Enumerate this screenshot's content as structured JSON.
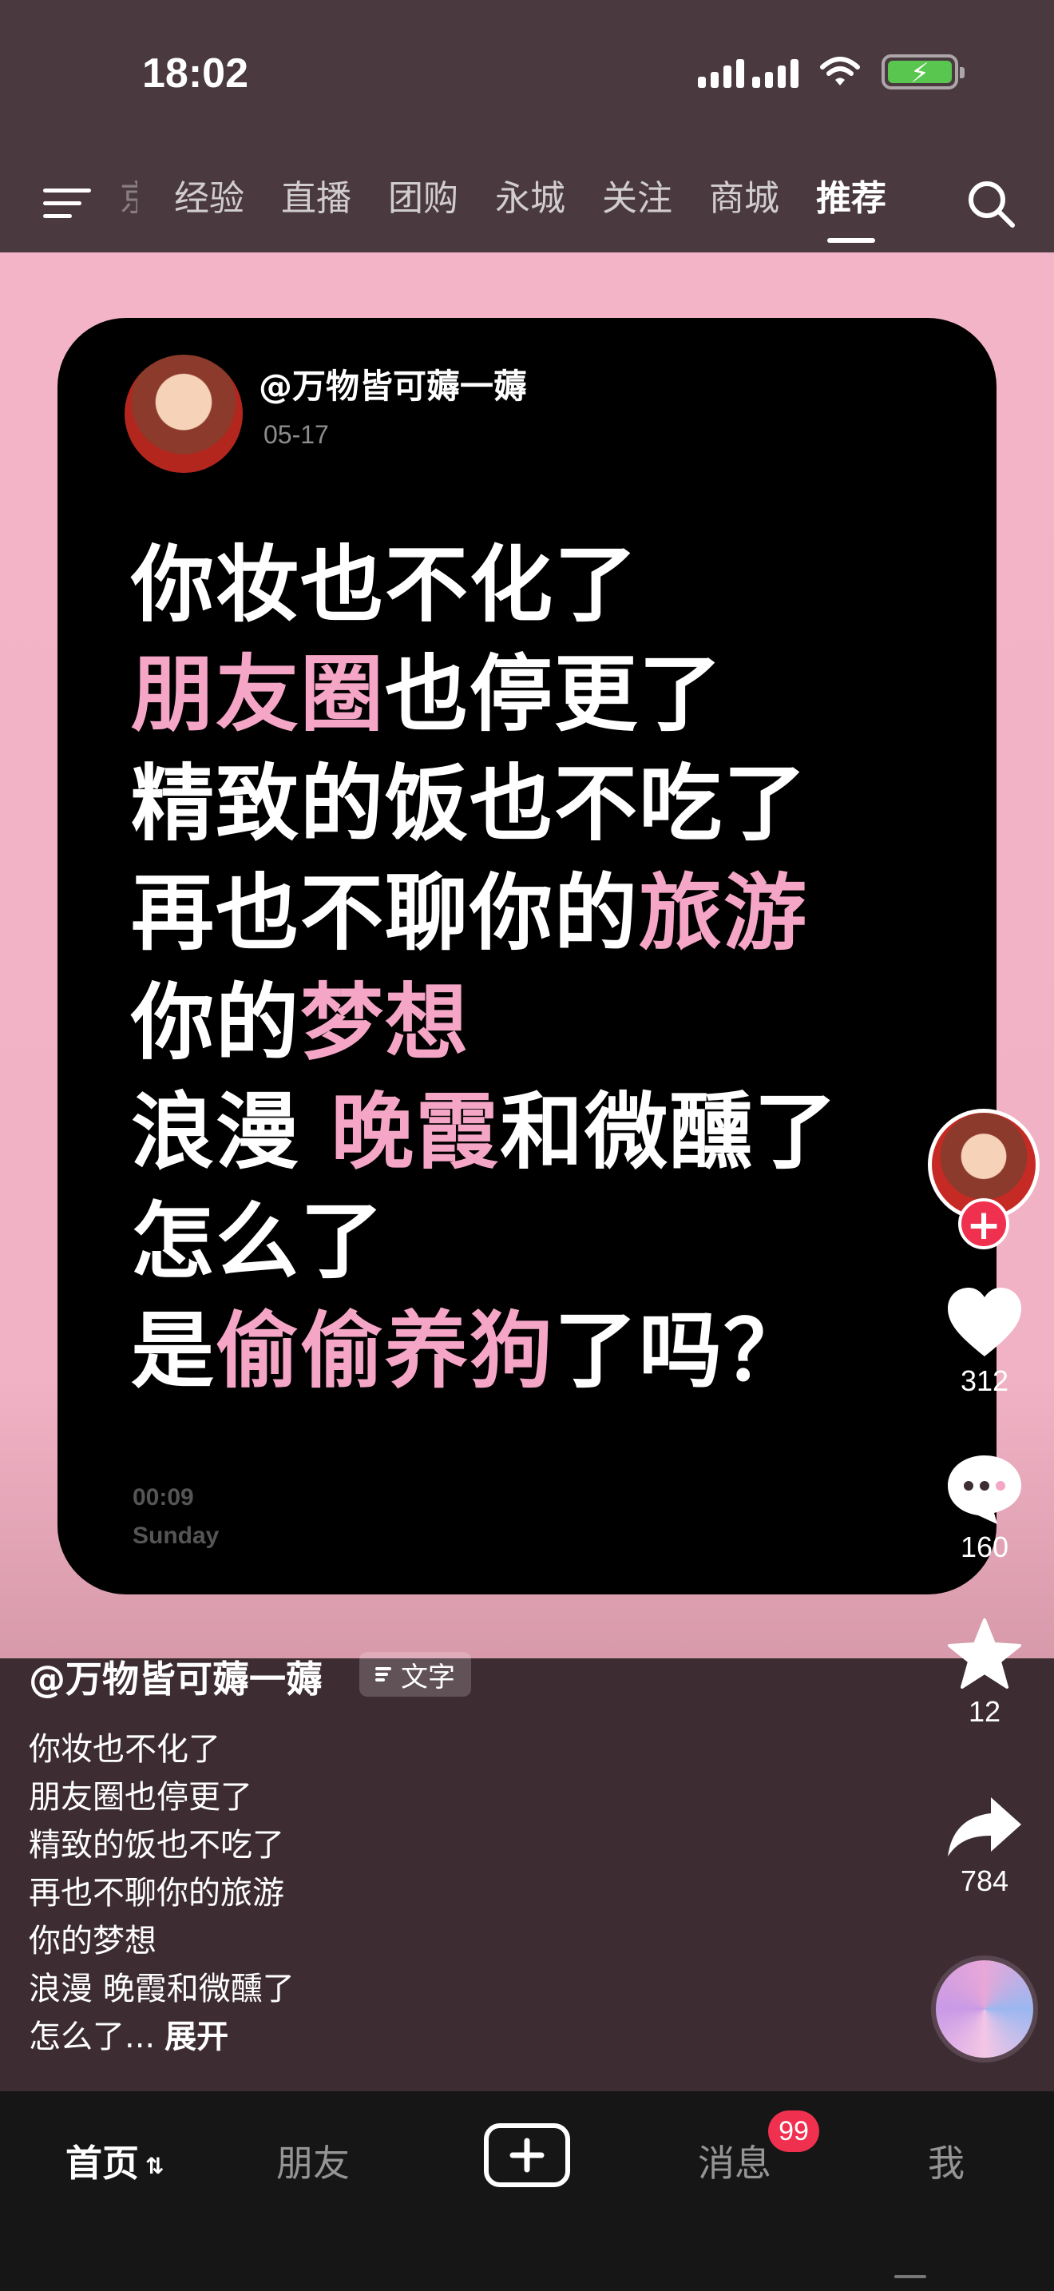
{
  "status_bar": {
    "time": "18:02"
  },
  "top_nav": {
    "tabs": [
      {
        "label": "京",
        "active": false,
        "faded": true
      },
      {
        "label": "经验",
        "active": false
      },
      {
        "label": "直播",
        "active": false
      },
      {
        "label": "团购",
        "active": false
      },
      {
        "label": "永城",
        "active": false
      },
      {
        "label": "关注",
        "active": false
      },
      {
        "label": "商城",
        "active": false
      },
      {
        "label": "推荐",
        "active": true
      }
    ]
  },
  "card": {
    "username": "@万物皆可薅一薅",
    "date": "05-17",
    "lines": [
      [
        {
          "text": "你妆也不化了",
          "pink": false
        }
      ],
      [
        {
          "text": "朋友圈",
          "pink": true
        },
        {
          "text": "也停更了",
          "pink": false
        }
      ],
      [
        {
          "text": "精致的饭也不吃了",
          "pink": false
        }
      ],
      [
        {
          "text": "再也不聊你的",
          "pink": false
        },
        {
          "text": "旅游",
          "pink": true
        }
      ],
      [
        {
          "text": "你的",
          "pink": false
        },
        {
          "text": "梦想",
          "pink": true
        }
      ],
      [
        {
          "text": "浪漫 ",
          "pink": false
        },
        {
          "text": "晚霞",
          "pink": true
        },
        {
          "text": "和微醺了",
          "pink": false
        }
      ],
      [
        {
          "text": "怎么了",
          "pink": false
        }
      ],
      [
        {
          "text": "是",
          "pink": false
        },
        {
          "text": "偷偷养狗",
          "pink": true
        },
        {
          "text": "了吗？",
          "pink": false
        }
      ]
    ],
    "time": "00:09",
    "day": "Sunday"
  },
  "actions": {
    "likes": "312",
    "comments": "160",
    "favorites": "12",
    "shares": "784"
  },
  "caption": {
    "username": "@万物皆可薅一薅",
    "tag": "文字",
    "lines": [
      "你妆也不化了",
      "朋友圈也停更了",
      "精致的饭也不吃了",
      "再也不聊你的旅游",
      "你的梦想",
      "浪漫 晚霞和微醺了",
      "怎么了..."
    ],
    "expand": "展开"
  },
  "bottom_nav": {
    "home": "首页",
    "friends": "朋友",
    "messages": "消息",
    "message_badge": "99",
    "me": "我"
  },
  "colors": {
    "accent_pink": "#f5a6c6",
    "badge_red": "#f0304f",
    "page_pink": "#f2b4c6"
  }
}
